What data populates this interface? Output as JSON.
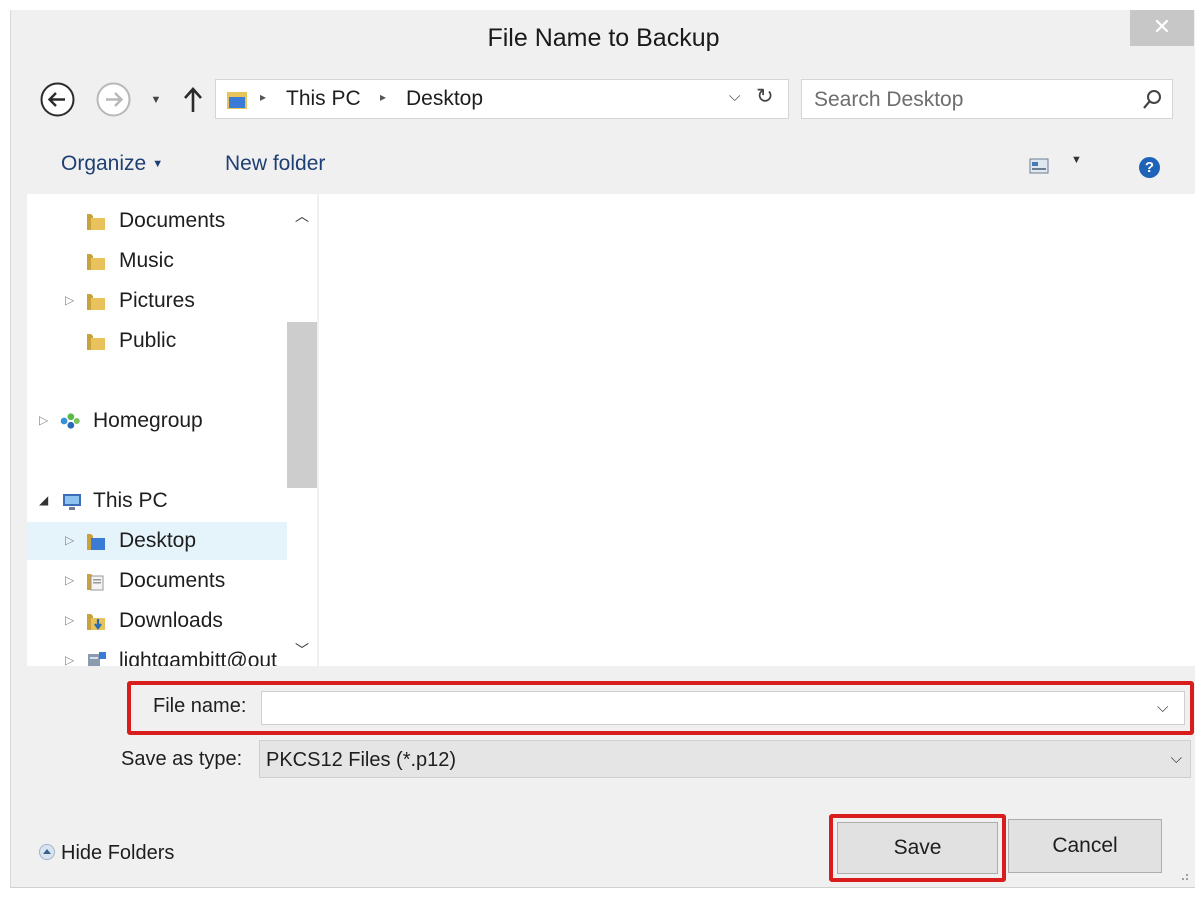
{
  "window": {
    "title": "File Name to Backup",
    "close_glyph": "✕"
  },
  "address": {
    "crumbs": [
      "This PC",
      "Desktop"
    ],
    "separator": "▸"
  },
  "search": {
    "placeholder": "Search Desktop"
  },
  "toolbar": {
    "organize_label": "Organize",
    "new_folder_label": "New folder",
    "help_glyph": "?"
  },
  "nav": {
    "items": [
      {
        "label": "Documents",
        "icon": "folder-icon"
      },
      {
        "label": "Music",
        "icon": "folder-icon"
      },
      {
        "label": "Pictures",
        "icon": "folder-icon",
        "expandable": true
      },
      {
        "label": "Public",
        "icon": "folder-icon"
      },
      {
        "label": "Homegroup",
        "icon": "homegroup-icon",
        "expandable": true
      },
      {
        "label": "This PC",
        "icon": "computer-icon",
        "expanded": true
      },
      {
        "label": "Desktop",
        "icon": "desktop-folder-icon",
        "expandable": true,
        "selected": true
      },
      {
        "label": "Documents",
        "icon": "documents-folder-icon",
        "expandable": true
      },
      {
        "label": "Downloads",
        "icon": "downloads-folder-icon",
        "expandable": true
      },
      {
        "label": "lightgambitt@out",
        "icon": "network-drive-icon",
        "expandable": true
      }
    ]
  },
  "form": {
    "filename_label": "File name:",
    "filename_value": "",
    "type_label": "Save as type:",
    "type_value": "PKCS12 Files (*.p12)"
  },
  "footer": {
    "hide_folders_label": "Hide Folders",
    "save_label": "Save",
    "cancel_label": "Cancel"
  },
  "colors": {
    "highlight_border": "#d91c1c",
    "link_text": "#1e3f73",
    "selected_row": "#e5f3fb",
    "folder": "#e8c25a"
  }
}
